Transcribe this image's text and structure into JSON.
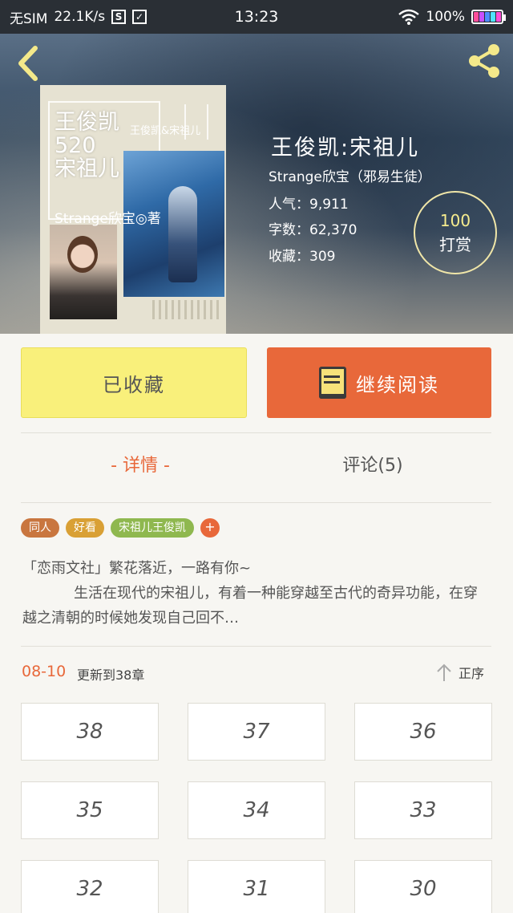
{
  "status_bar": {
    "sim": "无SIM",
    "speed": "22.1K/s",
    "time": "13:23",
    "battery": "100%"
  },
  "book": {
    "title": "王俊凯:宋祖儿",
    "author": "Strange欣宝（邪易生徒）",
    "popularity": "人气：9,911",
    "words": "字数：62,370",
    "favorites": "收藏：309",
    "cover": {
      "title_lines": [
        "王俊凯",
        "520",
        "宋祖儿"
      ],
      "subtitle": "王俊凯&宋祖儿",
      "author_line": "Strange欣宝◎著"
    }
  },
  "reward": {
    "amount": "100",
    "label": "打赏"
  },
  "actions": {
    "collected_label": "已收藏",
    "continue_label": "继续阅读"
  },
  "tabs": {
    "detail": "- 详情 -",
    "comments": "评论(5)"
  },
  "tags": [
    {
      "label": "同人",
      "color": "#c9763f"
    },
    {
      "label": "好看",
      "color": "#d9a035"
    },
    {
      "label": "宋祖儿王俊凯",
      "color": "#8fb84f"
    }
  ],
  "tag_add": "+",
  "intro": {
    "line1": "「恋雨文社」繁花落近，一路有你~",
    "line2": "生活在现代的宋祖儿，有着一种能穿越至古代的奇异功能，在穿越之清朝的时候她发现自己回不…"
  },
  "update": {
    "date": "08-10",
    "text": "更新到38章",
    "sort_label": "正序"
  },
  "chapters": [
    "38",
    "37",
    "36",
    "35",
    "34",
    "33",
    "32",
    "31",
    "30"
  ],
  "colors": {
    "accent": "#e8683a",
    "collect_button": "#f9f07b",
    "background": "#f7f6f2"
  }
}
